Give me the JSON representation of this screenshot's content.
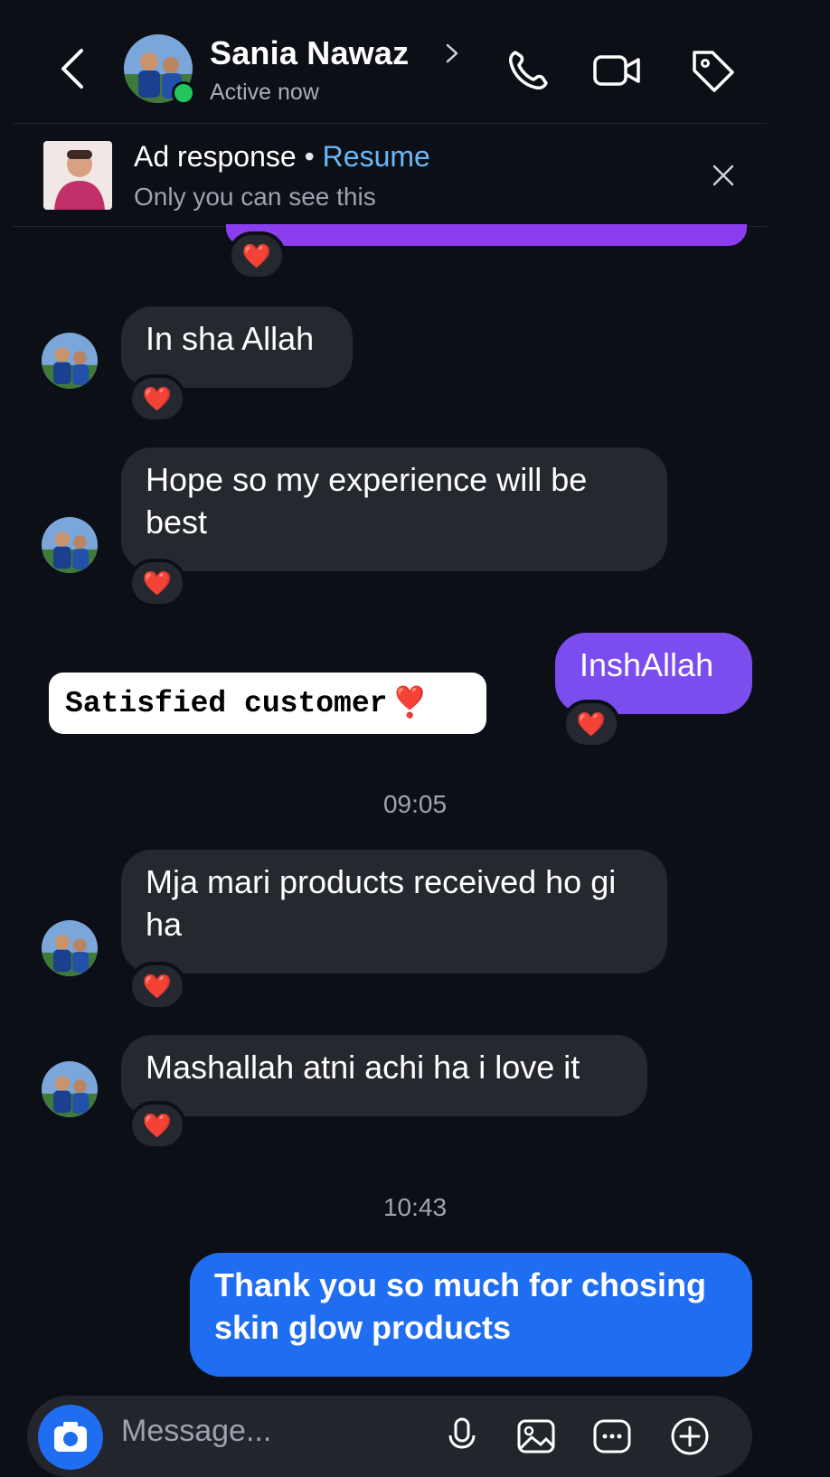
{
  "header": {
    "contact_name": "Sania Nawaz",
    "status": "Active now",
    "icons": [
      "back-arrow-icon",
      "avatar",
      "chevron-right-icon",
      "phone-icon",
      "video-camera-icon",
      "tag-icon"
    ]
  },
  "ad_banner": {
    "title": "Ad response",
    "separator": "•",
    "action": "Resume",
    "subtitle": "Only you can see this",
    "close_icon": "close-icon"
  },
  "messages": [
    {
      "side": "in",
      "text": "In sha Allah",
      "reaction": "❤️"
    },
    {
      "side": "in",
      "text": "Hope so my experience will be best",
      "reaction": "❤️"
    },
    {
      "side": "out",
      "text": "InshAllah",
      "reaction": "❤️"
    },
    {
      "side": "in",
      "text": "Mja mari products received ho gi ha",
      "reaction": "❤️"
    },
    {
      "side": "in",
      "text": "Mashallah atni achi ha i love it",
      "reaction": "❤️"
    },
    {
      "side": "out",
      "text": "Thank you so much for chosing skin glow products"
    }
  ],
  "top_reaction": "❤️",
  "timestamps": [
    "09:05",
    "10:43"
  ],
  "overlay_badge": {
    "text": "Satisfied customer",
    "emoji": "❣️"
  },
  "composer": {
    "placeholder": "Message...",
    "icons": [
      "camera-icon",
      "microphone-icon",
      "gallery-icon",
      "sticker-icon",
      "add-icon"
    ]
  },
  "colors": {
    "background": "#0d0f17",
    "incoming_bubble": "#262830",
    "outgoing_purple": "#7b4dee",
    "outgoing_blue": "#1f6df0",
    "link": "#6ab8f7",
    "online": "#22c55e"
  }
}
